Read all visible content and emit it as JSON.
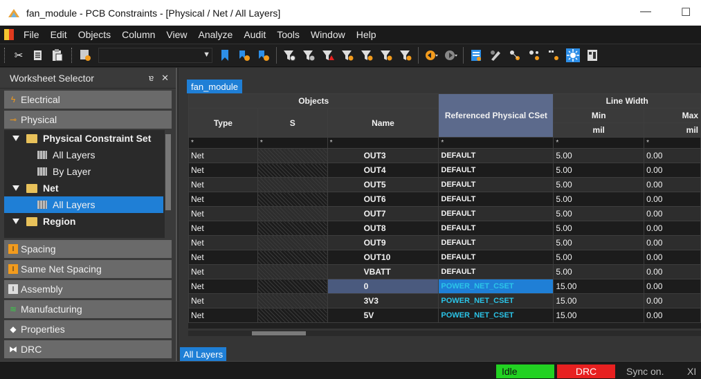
{
  "window": {
    "title": "fan_module - PCB Constraints - [Physical / Net / All Layers]",
    "minimize": "—",
    "maximize": "☐"
  },
  "menu": [
    "File",
    "Edit",
    "Objects",
    "Column",
    "View",
    "Analyze",
    "Audit",
    "Tools",
    "Window",
    "Help"
  ],
  "toolbar": {
    "icons": [
      "cut-icon",
      "copy-icon",
      "paste-icon",
      "filter-combo-icon"
    ]
  },
  "panel": {
    "title": "Worksheet Selector",
    "pin": "ɐ",
    "close": "✕",
    "categories_top": [
      {
        "label": "Electrical",
        "icon": "electrical-icon"
      },
      {
        "label": "Physical",
        "icon": "physical-icon"
      }
    ],
    "tree": [
      {
        "label": "Physical Constraint Set",
        "level": 0,
        "type": "folder"
      },
      {
        "label": "All Layers",
        "level": 1,
        "type": "sheet"
      },
      {
        "label": "By Layer",
        "level": 1,
        "type": "sheet"
      },
      {
        "label": "Net",
        "level": 0,
        "type": "folder"
      },
      {
        "label": "All Layers",
        "level": 1,
        "type": "sheet",
        "selected": true
      },
      {
        "label": "Region",
        "level": 0,
        "type": "folder"
      }
    ],
    "categories_bottom": [
      {
        "label": "Spacing",
        "icon": "spacing-icon"
      },
      {
        "label": "Same Net Spacing",
        "icon": "same-net-spacing-icon"
      },
      {
        "label": "Assembly",
        "icon": "assembly-icon"
      },
      {
        "label": "Manufacturing",
        "icon": "manufacturing-icon"
      },
      {
        "label": "Properties",
        "icon": "properties-icon"
      },
      {
        "label": "DRC",
        "icon": "drc-icon"
      }
    ]
  },
  "main": {
    "doc_tab": "fan_module",
    "bottom_tab": "All Layers",
    "headers": {
      "objects": "Objects",
      "type": "Type",
      "s": "S",
      "name": "Name",
      "ref_cset": "Referenced Physical CSet",
      "line_width": "Line Width",
      "min": "Min",
      "max": "Max",
      "unit_min": "mil",
      "unit_max": "mil"
    },
    "filter": [
      "*",
      "*",
      "*",
      "*",
      "*",
      "*"
    ],
    "rows": [
      {
        "type": "Net",
        "name": "OUT3",
        "cset": "DEFAULT",
        "min": "5.00",
        "max": "0.00"
      },
      {
        "type": "Net",
        "name": "OUT4",
        "cset": "DEFAULT",
        "min": "5.00",
        "max": "0.00"
      },
      {
        "type": "Net",
        "name": "OUT5",
        "cset": "DEFAULT",
        "min": "5.00",
        "max": "0.00"
      },
      {
        "type": "Net",
        "name": "OUT6",
        "cset": "DEFAULT",
        "min": "5.00",
        "max": "0.00"
      },
      {
        "type": "Net",
        "name": "OUT7",
        "cset": "DEFAULT",
        "min": "5.00",
        "max": "0.00"
      },
      {
        "type": "Net",
        "name": "OUT8",
        "cset": "DEFAULT",
        "min": "5.00",
        "max": "0.00"
      },
      {
        "type": "Net",
        "name": "OUT9",
        "cset": "DEFAULT",
        "min": "5.00",
        "max": "0.00"
      },
      {
        "type": "Net",
        "name": "OUT10",
        "cset": "DEFAULT",
        "min": "5.00",
        "max": "0.00"
      },
      {
        "type": "Net",
        "name": "VBATT",
        "cset": "DEFAULT",
        "min": "5.00",
        "max": "0.00"
      },
      {
        "type": "Net",
        "name": "0",
        "cset": "POWER_NET_CSET",
        "min": "15.00",
        "max": "0.00",
        "selected": true
      },
      {
        "type": "Net",
        "name": "3V3",
        "cset": "POWER_NET_CSET",
        "min": "15.00",
        "max": "0.00"
      },
      {
        "type": "Net",
        "name": "5V",
        "cset": "POWER_NET_CSET",
        "min": "15.00",
        "max": "0.00"
      }
    ]
  },
  "status": {
    "idle": "Idle",
    "drc": "DRC",
    "sync": "Sync on.",
    "x": "XI"
  },
  "colors": {
    "accent": "#1f7fd6",
    "power_cset": "#2bc4e8",
    "idle": "#22d222",
    "drc": "#e82020"
  }
}
